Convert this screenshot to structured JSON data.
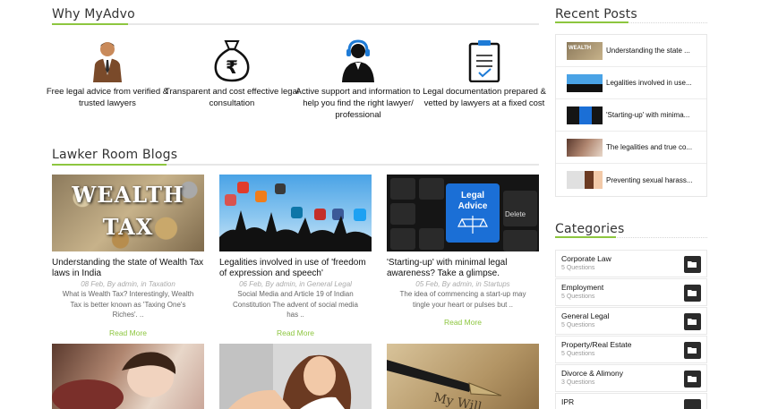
{
  "why": {
    "title": "Why MyAdvo",
    "features": [
      {
        "icon": "lawyer-icon",
        "text": "Free legal advice from verified & trusted lawyers"
      },
      {
        "icon": "rupee-moneybag-icon",
        "text": "Transparent and cost effective legal consultation"
      },
      {
        "icon": "support-agent-icon",
        "text": "Active support and information to help you find the right lawyer/ professional"
      },
      {
        "icon": "clipboard-document-icon",
        "text": "Legal documentation prepared & vetted by lawyers at a fixed cost"
      }
    ]
  },
  "blogs": {
    "title": "Lawker Room Blogs",
    "read_more": "Read More",
    "cards": [
      {
        "title": "Understanding the state of Wealth Tax laws in India",
        "meta": "08 Feb, By admin, in Taxation",
        "excerpt": "What is Wealth Tax? Interestingly, Wealth Tax is better known as 'Taxing One's Riches'. ..",
        "thumb_text_1": "WEALTH",
        "thumb_text_2": "TAX"
      },
      {
        "title": "Legalities involved in use of 'freedom of expression and speech'",
        "meta": "06 Feb, By admin, in General Legal",
        "excerpt": "Social Media and Article 19 of Indian Constitution The advent of social media has ..",
        "thumb_text_1": "",
        "thumb_text_2": ""
      },
      {
        "title": "'Starting-up' with minimal legal awareness? Take a glimpse.",
        "meta": "05 Feb, By admin, in Startups",
        "excerpt": "The idea of commencing a start-up may tingle your heart or pulses but ..",
        "thumb_text_1": "Legal Advice",
        "thumb_text_2": "Delete"
      }
    ],
    "bottom_thumb_text": "My Will"
  },
  "recent": {
    "title": "Recent Posts",
    "items": [
      {
        "title": "Understanding the state ..."
      },
      {
        "title": "Legalities involved in use..."
      },
      {
        "title": "'Starting-up' with minima..."
      },
      {
        "title": "The legalities and true co..."
      },
      {
        "title": "Preventing sexual harass..."
      }
    ]
  },
  "categories": {
    "title": "Categories",
    "items": [
      {
        "name": "Corporate Law",
        "count": "5 Questions"
      },
      {
        "name": "Employment",
        "count": "5 Questions"
      },
      {
        "name": "General Legal",
        "count": "5 Questions"
      },
      {
        "name": "Property/Real Estate",
        "count": "5 Questions"
      },
      {
        "name": "Divorce & Alimony",
        "count": "3 Questions"
      },
      {
        "name": "IPR",
        "count": ""
      }
    ]
  },
  "colors": {
    "accent": "#8dc63f",
    "folder_button": "#2b2b2b"
  }
}
